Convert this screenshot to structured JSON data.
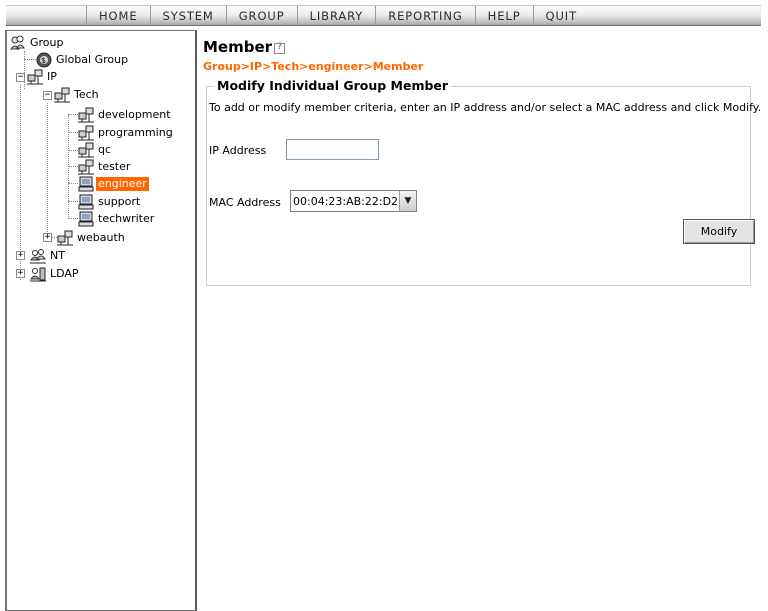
{
  "nav": {
    "items": [
      "HOME",
      "SYSTEM",
      "GROUP",
      "LIBRARY",
      "REPORTING",
      "HELP",
      "QUIT"
    ]
  },
  "tree": {
    "group": "Group",
    "global_group": "Global Group",
    "ip": "IP",
    "tech": "Tech",
    "development": "development",
    "programming": "programming",
    "qc": "qc",
    "tester": "tester",
    "engineer": "engineer",
    "support": "support",
    "techwriter": "techwriter",
    "webauth": "webauth",
    "nt": "NT",
    "ldap": "LDAP",
    "expand_plus": "+",
    "expand_minus": "−"
  },
  "main": {
    "title": "Member",
    "breadcrumb": "Group>IP>Tech>engineer>Member",
    "section_title": "Modify Individual Group Member",
    "instructions": "To add or modify member criteria, enter an IP address and/or select a MAC address and click Modify.",
    "ip_label": "IP Address",
    "ip_value": "",
    "mac_label": "MAC Address",
    "mac_value": "00:04:23:AB:22:D2",
    "modify_label": "Modify"
  },
  "colors": {
    "accent": "#ff6600",
    "selected_bg": "#ff6600"
  }
}
